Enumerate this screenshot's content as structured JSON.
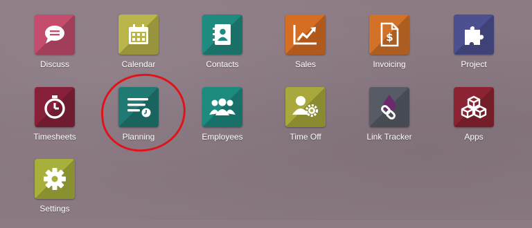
{
  "apps": [
    {
      "label": "Discuss",
      "icon": "chat-bubble-icon",
      "color": "#c44d6e"
    },
    {
      "label": "Calendar",
      "icon": "calendar-icon",
      "color": "#b9b54a"
    },
    {
      "label": "Contacts",
      "icon": "address-book-icon",
      "color": "#1f8a7f"
    },
    {
      "label": "Sales",
      "icon": "trend-chart-icon",
      "color": "#d56d22"
    },
    {
      "label": "Invoicing",
      "icon": "invoice-dollar-icon",
      "color": "#d27128"
    },
    {
      "label": "Project",
      "icon": "puzzle-piece-icon",
      "color": "#4c5090"
    },
    {
      "label": "Timesheets",
      "icon": "stopwatch-icon",
      "color": "#87213a"
    },
    {
      "label": "Planning",
      "icon": "planning-list-clock-icon",
      "color": "#1f7a74"
    },
    {
      "label": "Employees",
      "icon": "people-group-icon",
      "color": "#1d8a7f"
    },
    {
      "label": "Time Off",
      "icon": "user-gear-icon",
      "color": "#a8a83c"
    },
    {
      "label": "Link Tracker",
      "icon": "chain-link-drop-icon",
      "color": "#575b65"
    },
    {
      "label": "Apps",
      "icon": "cubes-icon",
      "color": "#8c2332"
    },
    {
      "label": "Settings",
      "icon": "gear-icon",
      "color": "#a7b03a"
    }
  ],
  "highlight": {
    "target": "Planning",
    "color": "#e0131a"
  }
}
